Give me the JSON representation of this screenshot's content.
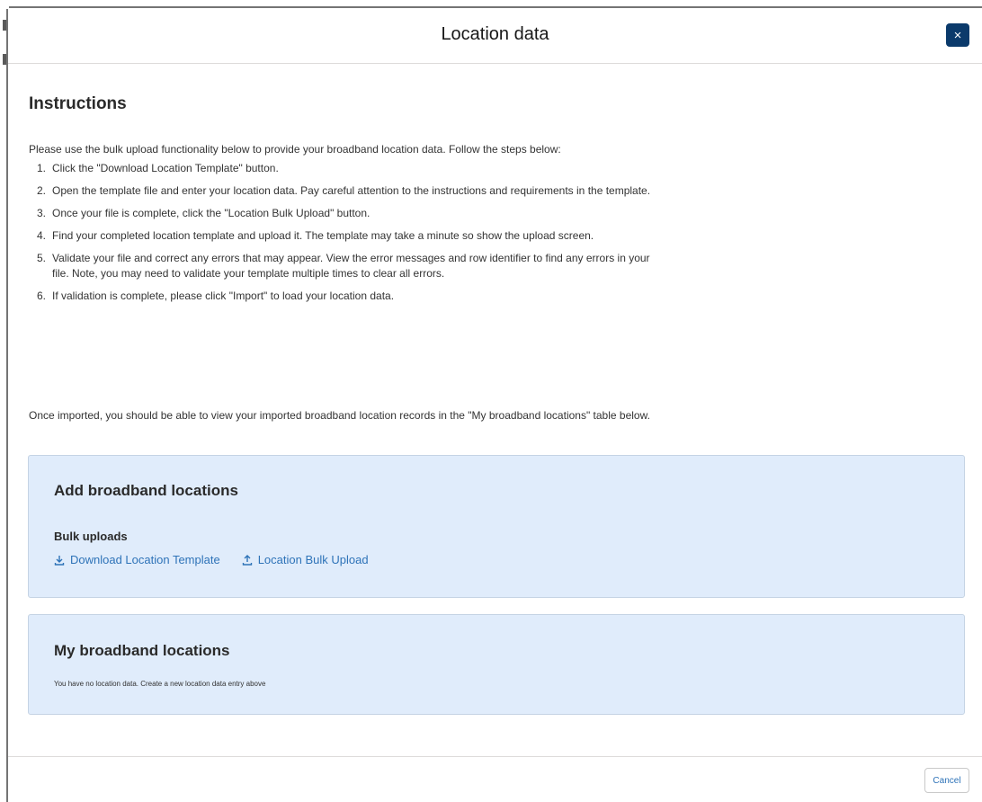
{
  "modal": {
    "title": "Location data",
    "close_icon": "close-icon",
    "close_glyph": "×"
  },
  "instructions": {
    "title": "Instructions",
    "intro": "Please use the bulk upload functionality below to provide your broadband location data. Follow the steps below:",
    "steps": [
      {
        "num": "1.",
        "text": "Click the \"Download Location Template\" button."
      },
      {
        "num": "2.",
        "text": "Open the template file and enter your location data. Pay careful attention to the instructions and requirements in the template."
      },
      {
        "num": "3.",
        "text": "Once your file is complete, click the \"Location Bulk Upload\" button."
      },
      {
        "num": "4.",
        "text": "Find your completed location template and upload it. The template may take a minute so show the upload screen."
      },
      {
        "num": "5.",
        "text": "Validate your file and correct any errors that may appear. View the error messages and row identifier to find any errors in your file. Note, you may need to validate your template multiple times to clear all errors."
      },
      {
        "num": "6.",
        "text": "If validation is complete, please click \"Import\" to load your location data."
      }
    ],
    "outro": "Once imported, you should be able to view your imported broadband location records in the \"My broadband locations\" table below."
  },
  "add_card": {
    "title": "Add broadband locations",
    "bulk_label": "Bulk uploads",
    "download_label": "Download Location Template",
    "download_icon": "download-icon",
    "upload_label": "Location Bulk Upload",
    "upload_icon": "upload-icon"
  },
  "my_card": {
    "title": "My broadband locations",
    "empty_message": "You have no location data. Create a new location data entry above"
  },
  "footer": {
    "cancel_label": "Cancel"
  },
  "colors": {
    "accent": "#0b3a6b",
    "link": "#2e73b8",
    "card_bg": "#e0ecfb"
  }
}
